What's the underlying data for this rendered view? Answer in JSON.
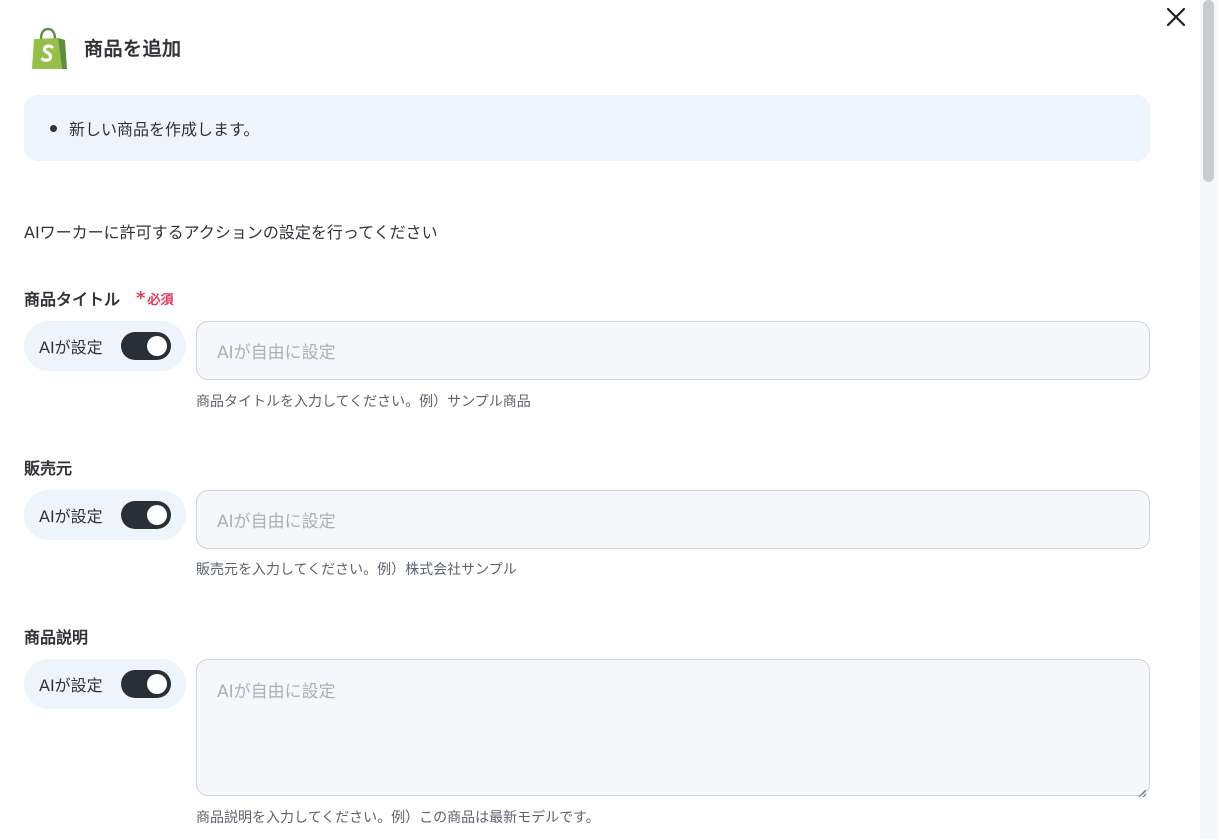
{
  "dialog": {
    "title": "商品を追加",
    "info_items": [
      "新しい商品を作成します。"
    ],
    "lead": "AIワーカーに許可するアクションの設定を行ってください",
    "required_label": "必須",
    "required_mark": "*",
    "brand_color": "#95bf47",
    "toggle_color": "#2a2e37"
  },
  "icons": {
    "logo": "shopify-bag-icon",
    "close": "close-icon"
  },
  "fields": [
    {
      "label": "商品タイトル",
      "required": true,
      "ai_toggle_label": "AIが設定",
      "ai_enabled": true,
      "placeholder": "AIが自由に設定",
      "value": "",
      "hint": "商品タイトルを入力してください。例）サンプル商品",
      "multiline": false
    },
    {
      "label": "販売元",
      "required": false,
      "ai_toggle_label": "AIが設定",
      "ai_enabled": true,
      "placeholder": "AIが自由に設定",
      "value": "",
      "hint": "販売元を入力してください。例）株式会社サンプル",
      "multiline": false
    },
    {
      "label": "商品説明",
      "required": false,
      "ai_toggle_label": "AIが設定",
      "ai_enabled": true,
      "placeholder": "AIが自由に設定",
      "value": "",
      "hint": "商品説明を入力してください。例）この商品は最新モデルです。",
      "multiline": true
    }
  ]
}
